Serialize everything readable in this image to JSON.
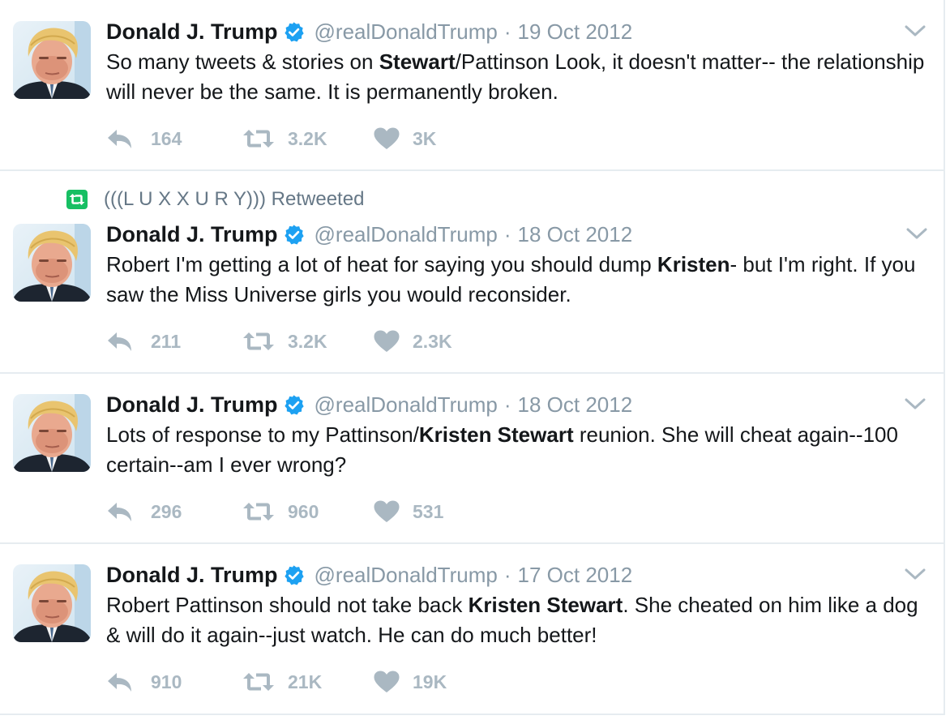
{
  "tweets": [
    {
      "name": "Donald J. Trump",
      "handle": "@realDonaldTrump",
      "separator": "·",
      "date": "19 Oct 2012",
      "text_parts": [
        {
          "t": "So many tweets & stories on ",
          "b": false
        },
        {
          "t": "Stewart",
          "b": true
        },
        {
          "t": "/Pattinson Look, it doesn't matter-- the relationship will never be the same. It is permanently broken.",
          "b": false
        }
      ],
      "replies": "164",
      "retweets": "3.2K",
      "likes": "3K"
    },
    {
      "retweeted_by": "(((L U X X U R Y))) Retweeted",
      "name": "Donald J. Trump",
      "handle": "@realDonaldTrump",
      "separator": "·",
      "date": "18 Oct 2012",
      "text_parts": [
        {
          "t": "Robert I'm getting a lot of heat for saying you should dump ",
          "b": false
        },
        {
          "t": "Kristen",
          "b": true
        },
        {
          "t": "- but I'm right. If you saw the Miss Universe girls you would reconsider.",
          "b": false
        }
      ],
      "replies": "211",
      "retweets": "3.2K",
      "likes": "2.3K"
    },
    {
      "name": "Donald J. Trump",
      "handle": "@realDonaldTrump",
      "separator": "·",
      "date": "18 Oct 2012",
      "text_parts": [
        {
          "t": "Lots of response to my Pattinson/",
          "b": false
        },
        {
          "t": "Kristen Stewart",
          "b": true
        },
        {
          "t": " reunion. She will cheat again--100 certain--am I ever wrong?",
          "b": false
        }
      ],
      "replies": "296",
      "retweets": "960",
      "likes": "531"
    },
    {
      "name": "Donald J. Trump",
      "handle": "@realDonaldTrump",
      "separator": "·",
      "date": "17 Oct 2012",
      "text_parts": [
        {
          "t": "Robert Pattinson should not take back ",
          "b": false
        },
        {
          "t": "Kristen Stewart",
          "b": true
        },
        {
          "t": ". She cheated on him like a dog & will do it again--just watch. He can do much better!",
          "b": false
        }
      ],
      "replies": "910",
      "retweets": "21K",
      "likes": "19K"
    }
  ],
  "colors": {
    "verified": "#1da1f2",
    "muted": "#8899a6",
    "action_icon": "#aab8c2",
    "retweet_badge": "#17bf63",
    "divider": "#e6ecf0"
  },
  "icons": {
    "reply": "reply-icon",
    "retweet": "retweet-icon",
    "like": "heart-icon",
    "verified": "verified-badge-icon",
    "caret": "chevron-down-icon"
  }
}
